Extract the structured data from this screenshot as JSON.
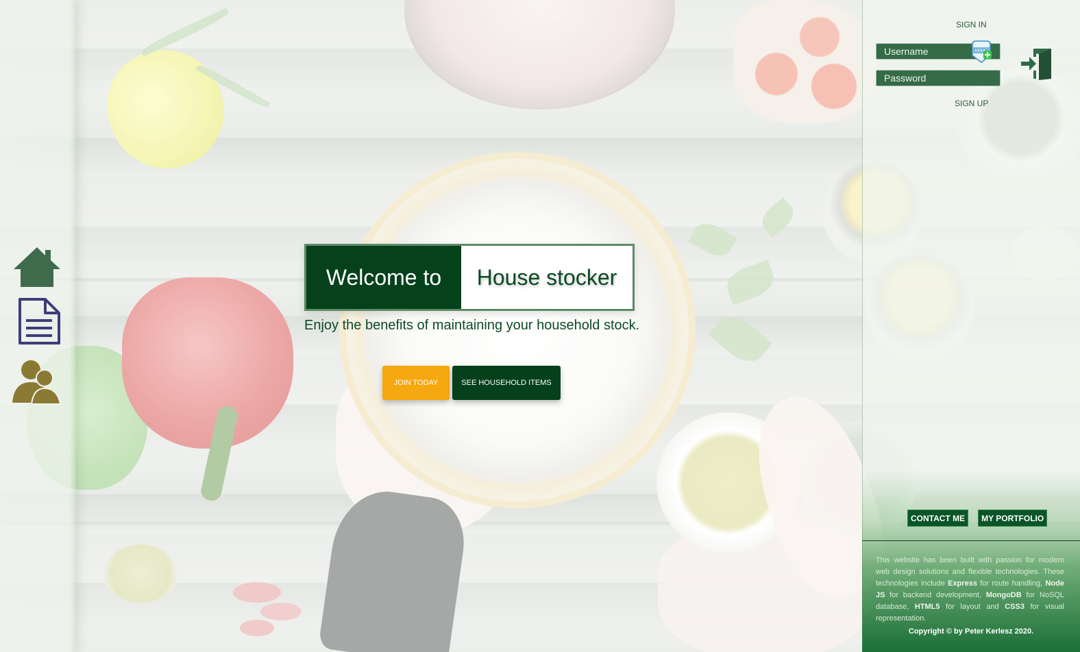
{
  "sidebar": {
    "items": [
      {
        "icon": "home-icon",
        "color": "#3f6b4d"
      },
      {
        "icon": "document-icon",
        "color": "#3d3d7a"
      },
      {
        "icon": "users-icon",
        "color": "#8b7a33"
      }
    ]
  },
  "hero": {
    "welcome_left": "Welcome to",
    "welcome_right": "House stocker",
    "tagline": "Enjoy the benefits of maintaining your household stock.",
    "join_button": "JOIN TODAY",
    "see_button": "SEE HOUSEHOLD ITEMS"
  },
  "auth": {
    "sign_in": "SIGN IN",
    "username_placeholder": "Username",
    "password_placeholder": "Password",
    "sign_up": "SIGN UP"
  },
  "footer": {
    "contact_button": "CONTACT ME",
    "portfolio_button": "MY PORTFOLIO",
    "about_parts": [
      "This website has been built with passion for modern web design solutions and flexible technologies. These technologies include ",
      "Express",
      " for route handling, ",
      "Node JS",
      " for backend development, ",
      "MongoDB",
      " for NoSQL database, ",
      "HTML5",
      " for layout and ",
      "CSS3",
      " for visual representation."
    ],
    "copyright": "Copyright © by Peter Kerlesz 2020."
  },
  "colors": {
    "brand_dark_green": "#05421c",
    "accent_orange": "#f5a80f",
    "input_green": "#356b47"
  }
}
